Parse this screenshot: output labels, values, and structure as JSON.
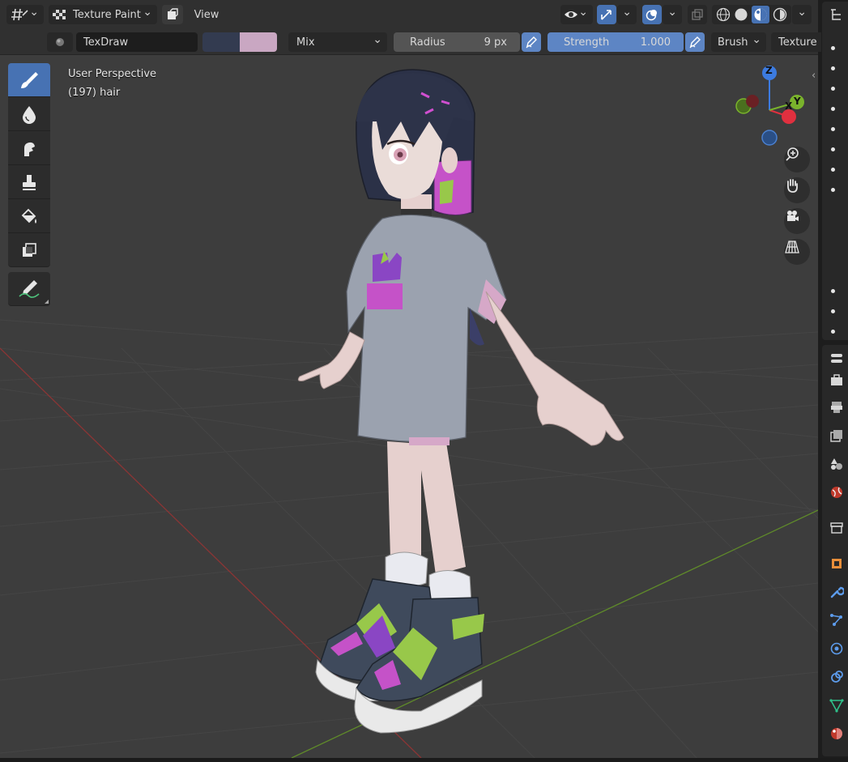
{
  "header": {
    "editor_type_icon": "editor-type-icon",
    "mode_label": "Texture Paint",
    "view_menu": "View"
  },
  "tool_settings": {
    "brush_name": "TexDraw",
    "primary_color": "#333b50",
    "secondary_color": "#c9a7c2",
    "blend_mode": "Mix",
    "radius_label": "Radius",
    "radius_value": "9 px",
    "strength_label": "Strength",
    "strength_value": "1.000",
    "brush_menu": "Brush",
    "texture_menu": "Texture"
  },
  "viewport": {
    "perspective_label": "User Perspective",
    "object_label": "(197) hair",
    "gizmo": {
      "z": "Z",
      "x": "X",
      "y": "Y"
    }
  },
  "toolbar": {
    "tools": [
      "draw-brush-icon",
      "soften-icon",
      "smear-icon",
      "clone-icon",
      "fill-icon",
      "mask-icon"
    ],
    "annotate": "annotate-icon"
  },
  "colors": {
    "accent": "#4772b3",
    "viewport_bg": "#3d3d3d",
    "grid_x_axis": "#9a3a3a",
    "grid_y_axis": "#6b8f2e"
  }
}
